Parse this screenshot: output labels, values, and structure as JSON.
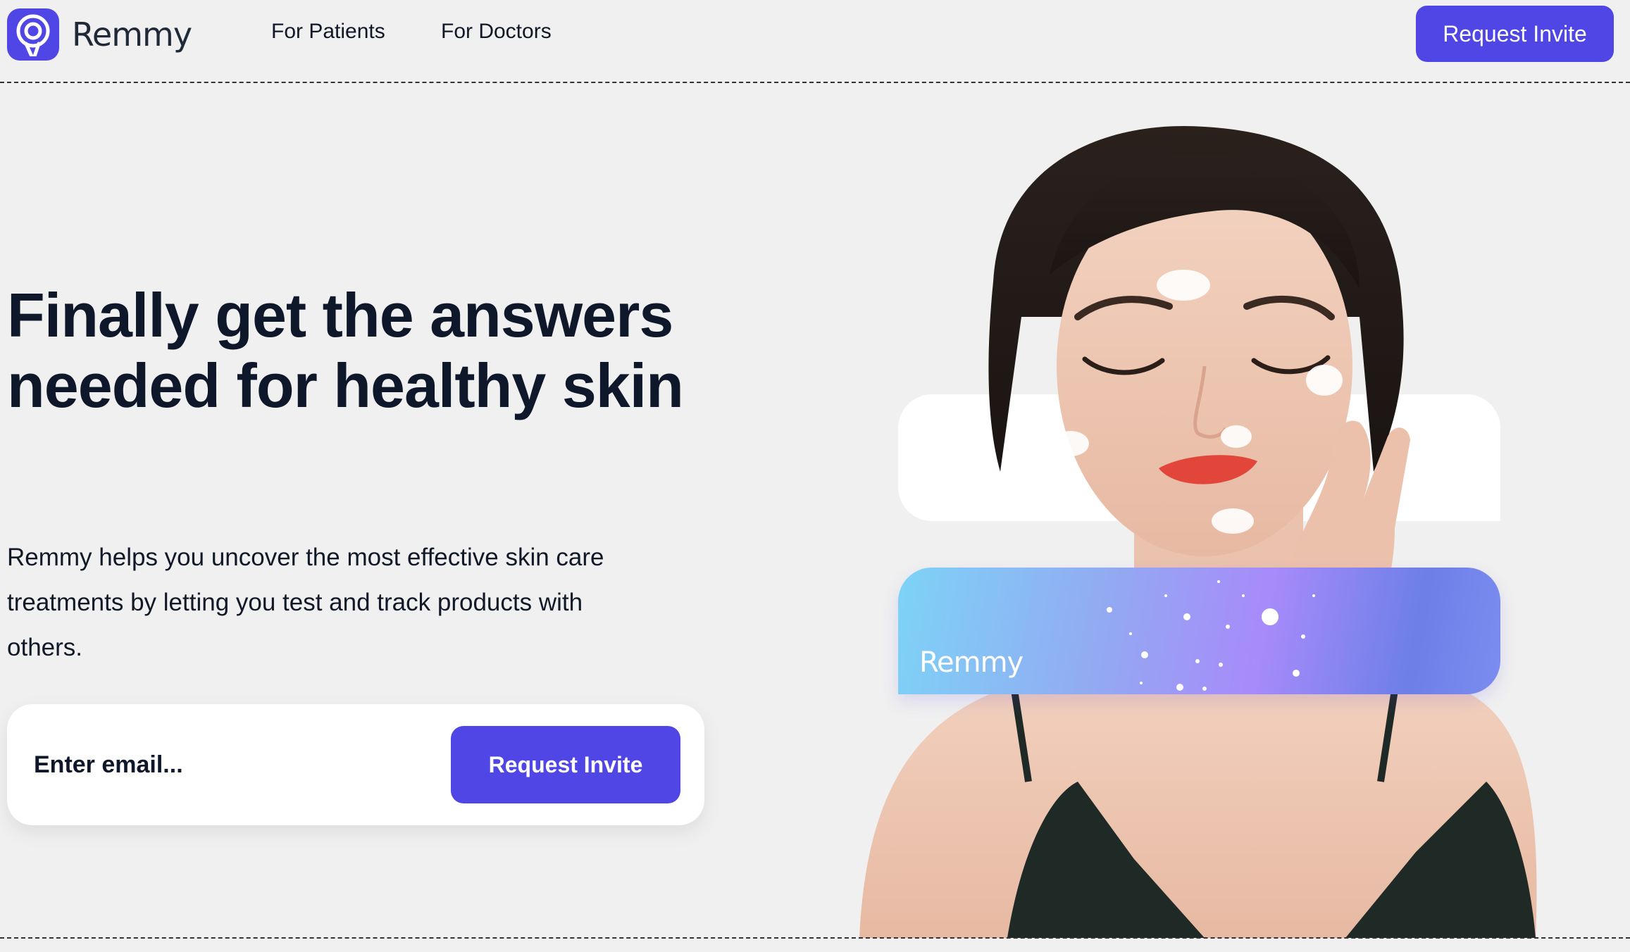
{
  "brand": {
    "name": "Remmy",
    "accent_color": "#4f46e5",
    "logo_icon": "remmy-logo-icon"
  },
  "nav": {
    "items": [
      {
        "label": "For Patients"
      },
      {
        "label": "For Doctors"
      }
    ],
    "cta_label": "Request Invite"
  },
  "hero": {
    "title_line1": "Finally get the answers",
    "title_line2": "needed for healthy skin",
    "description": "Remmy helps you uncover the most effective skin care treatments by letting you test and track products with others.",
    "email_placeholder": "Enter email...",
    "cta_label": "Request Invite"
  },
  "visual": {
    "image": "woman-applying-skin-cream-photo",
    "card_label": "Remmy"
  }
}
